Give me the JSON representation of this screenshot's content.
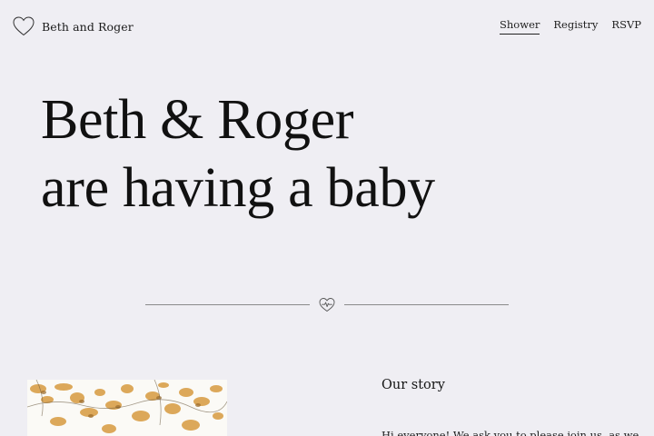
{
  "header": {
    "brand_label": "Beth and Roger",
    "brand_icon": "heart-outline-icon",
    "nav": [
      {
        "label": "Shower",
        "active": true
      },
      {
        "label": "Registry",
        "active": false
      },
      {
        "label": "RSVP",
        "active": false
      }
    ]
  },
  "hero": {
    "line1": "Beth & Roger",
    "line2": "are having a baby"
  },
  "divider": {
    "icon": "heart-heartbeat-icon"
  },
  "story": {
    "heading": "Our story",
    "body": "Hi everyone! We ask you to please join us, as we"
  },
  "colors": {
    "background": "#efeef3",
    "text": "#141414",
    "divider_line": "#8a8a8a",
    "photo_accent": "#d9a04a"
  }
}
